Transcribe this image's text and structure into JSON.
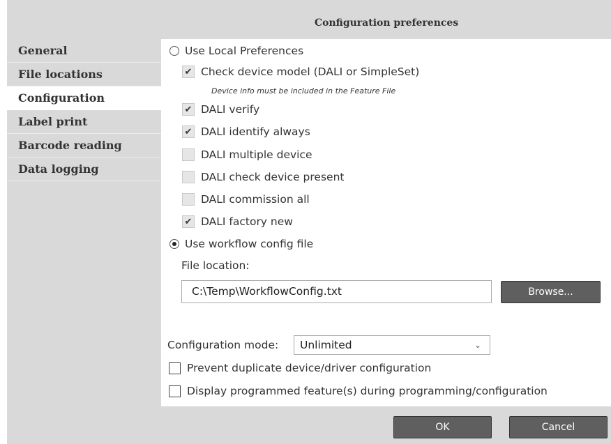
{
  "dialog": {
    "title": "Configuration preferences"
  },
  "sidebar": {
    "items": [
      {
        "label": "General"
      },
      {
        "label": "File locations"
      },
      {
        "label": "Configuration"
      },
      {
        "label": "Label print"
      },
      {
        "label": "Barcode reading"
      },
      {
        "label": "Data logging"
      }
    ],
    "active": "Configuration"
  },
  "config": {
    "local_prefs_label": "Use Local Preferences",
    "check_device_model_label": "Check device model (DALI or SimpleSet)",
    "device_info_note": "Device info must be included in the Feature File",
    "dali_verify_label": "DALI verify",
    "dali_identify_label": "DALI identify always",
    "dali_multiple_label": "DALI multiple device",
    "dali_check_present_label": "DALI check device present",
    "dali_commission_label": "DALI commission all",
    "dali_factory_new_label": "DALI factory new",
    "workflow_label": "Use workflow config file",
    "file_location_label": "File location:",
    "file_location_value": "C:\\Temp\\WorkflowConfig.txt",
    "browse_label": "Browse...",
    "mode_label": "Configuration mode:",
    "mode_value": "Unlimited",
    "prevent_duplicate_label": "Prevent duplicate device/driver configuration",
    "display_programmed_label": "Display programmed feature(s) during programming/configuration"
  },
  "state": {
    "radio_local": false,
    "radio_workflow": true,
    "check_device_model": true,
    "dali_verify": true,
    "dali_identify": true,
    "dali_multiple": false,
    "dali_check_present": false,
    "dali_commission": false,
    "dali_factory_new": true,
    "prevent_duplicate": false,
    "display_programmed": false
  },
  "footer": {
    "ok_label": "OK",
    "cancel_label": "Cancel"
  },
  "icons": {
    "checkmark": "check-icon",
    "chevron": "chevron-down-icon"
  }
}
